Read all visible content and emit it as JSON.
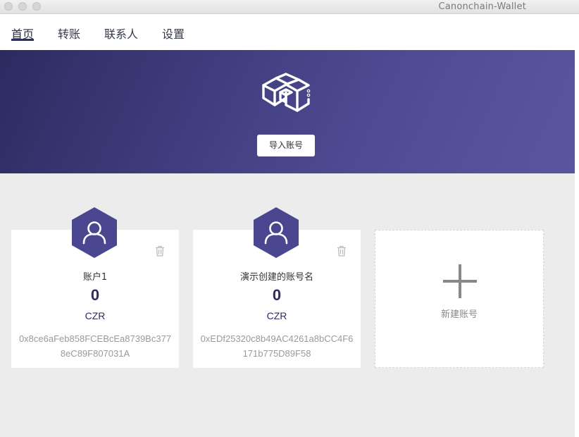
{
  "window": {
    "title": "Canonchain-Wallet"
  },
  "nav": {
    "items": [
      {
        "label": "首页",
        "active": true
      },
      {
        "label": "转账"
      },
      {
        "label": "联系人"
      },
      {
        "label": "设置"
      }
    ]
  },
  "banner": {
    "import_label": "导入账号",
    "logo_icon": "cube-cluster-icon"
  },
  "accounts": [
    {
      "name": "账户1",
      "balance": "0",
      "unit": "CZR",
      "address": "0x8ce6aFeb858FCEBcEa8739Bc3778eC89F807031A"
    },
    {
      "name": "演示创建的账号名",
      "balance": "0",
      "unit": "CZR",
      "address": "0xEDf25320c8b49AC4261a8bCC4F6171b775D89F58"
    }
  ],
  "new_account": {
    "label": "新建账号"
  },
  "colors": {
    "accent": "#2d2c5c",
    "banner_start": "#2d2a60",
    "banner_end": "#5a559f",
    "hex": "#4a4790"
  }
}
